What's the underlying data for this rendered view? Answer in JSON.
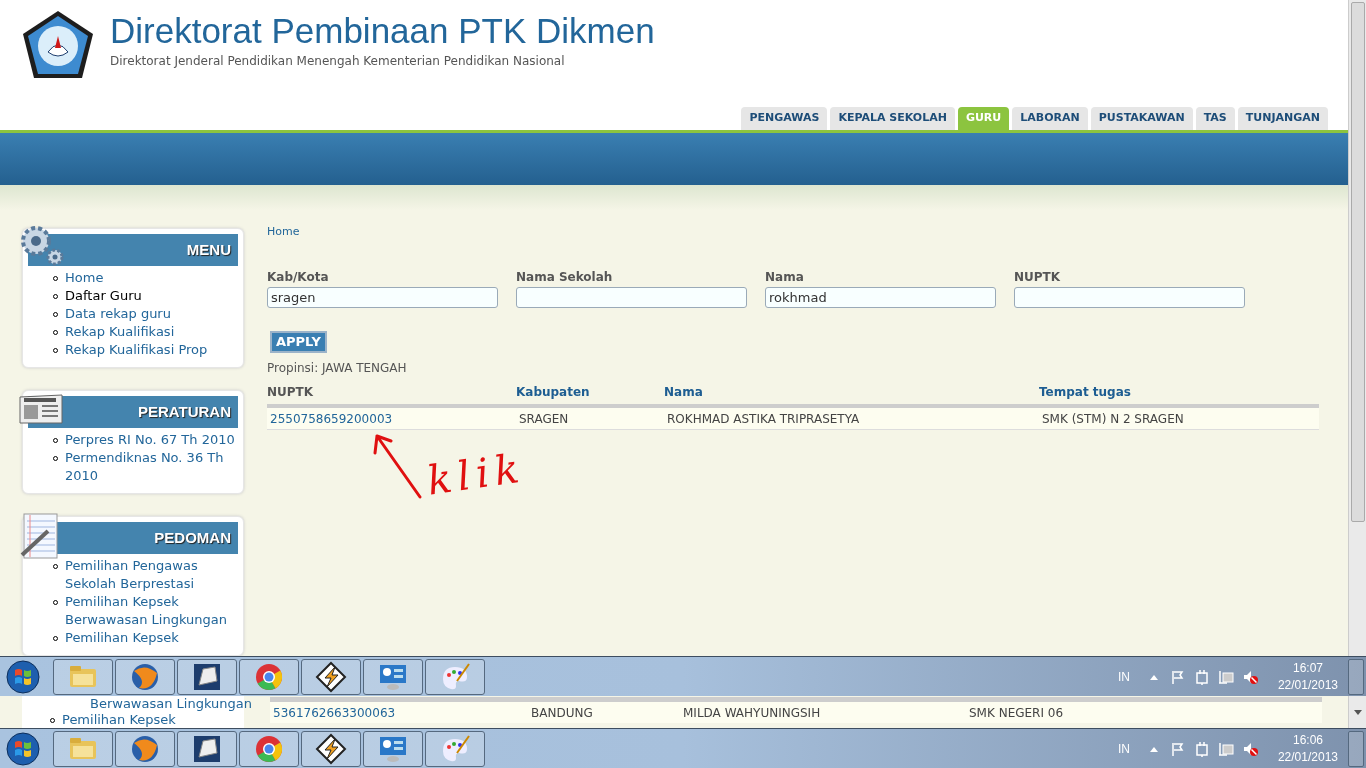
{
  "header": {
    "title": "Direktorat Pembinaan PTK Dikmen",
    "subtitle": "Direktorat Jenderal Pendidikan Menengah Kementerian Pendidikan Nasional"
  },
  "tabs": [
    {
      "label": "PENGAWAS",
      "selected": false
    },
    {
      "label": "KEPALA SEKOLAH",
      "selected": false
    },
    {
      "label": "GURU",
      "selected": true
    },
    {
      "label": "LABORAN",
      "selected": false
    },
    {
      "label": "PUSTAKAWAN",
      "selected": false
    },
    {
      "label": "TAS",
      "selected": false
    },
    {
      "label": "TUNJANGAN",
      "selected": false
    }
  ],
  "sidebar": [
    {
      "title": "MENU",
      "kind": "gears",
      "items": [
        {
          "label": "Home",
          "selected": false
        },
        {
          "label": "Daftar Guru",
          "selected": true
        },
        {
          "label": "Data rekap guru",
          "selected": false
        },
        {
          "label": "Rekap Kualifikasi",
          "selected": false
        },
        {
          "label": "Rekap Kualifikasi Prop",
          "selected": false
        }
      ]
    },
    {
      "title": "PERATURAN",
      "kind": "news",
      "items": [
        {
          "label": "Perpres RI No. 67 Th 2010",
          "selected": false
        },
        {
          "label": "Permendiknas No. 36 Th 2010",
          "selected": false
        }
      ]
    },
    {
      "title": "PEDOMAN",
      "kind": "notes",
      "items": [
        {
          "label": "Pemilihan Pengawas Sekolah Berprestasi",
          "selected": false
        },
        {
          "label": "Pemilihan Kepsek Berwawasan Lingkungan",
          "selected": false
        },
        {
          "label": "Pemilihan Kepsek",
          "selected": false
        }
      ]
    }
  ],
  "breadcrumb": "Home",
  "filters": [
    {
      "label": "Kab/Kota",
      "value": "sragen"
    },
    {
      "label": "Nama Sekolah"
    },
    {
      "label": "Nama",
      "value": "rokhmad"
    },
    {
      "label": "NUPTK"
    }
  ],
  "apply_button": "APPLY",
  "province": "Propinsi: JAWA TENGAH",
  "table": {
    "columns": [
      {
        "label": "NUPTK",
        "link": false
      },
      {
        "label": "Kabupaten",
        "link": true
      },
      {
        "label": "Nama",
        "link": true
      },
      {
        "label": "Tempat tugas",
        "link": true
      }
    ],
    "rows": [
      [
        "2550758659200003",
        "SRAGEN",
        "ROKHMAD ASTIKA TRIPRASETYA",
        "SMK (STM) N 2 SRAGEN"
      ]
    ]
  },
  "annotation": "klik",
  "taskbar": {
    "language": "IN",
    "time": "16:07",
    "date": "22/01/2013"
  },
  "underlying_screen": {
    "sidebar_items": [
      {
        "label": "Berwawasan Lingkungan",
        "bullet": false
      },
      {
        "label": "Pemilihan Kepsek",
        "bullet": true
      }
    ],
    "table_row": [
      "5361762663300063",
      "BANDUNG",
      "MILDA WAHYUNINGSIH",
      "SMK NEGERI 06"
    ],
    "taskbar": {
      "language": "IN",
      "time": "16:06",
      "date": "22/01/2013"
    }
  }
}
